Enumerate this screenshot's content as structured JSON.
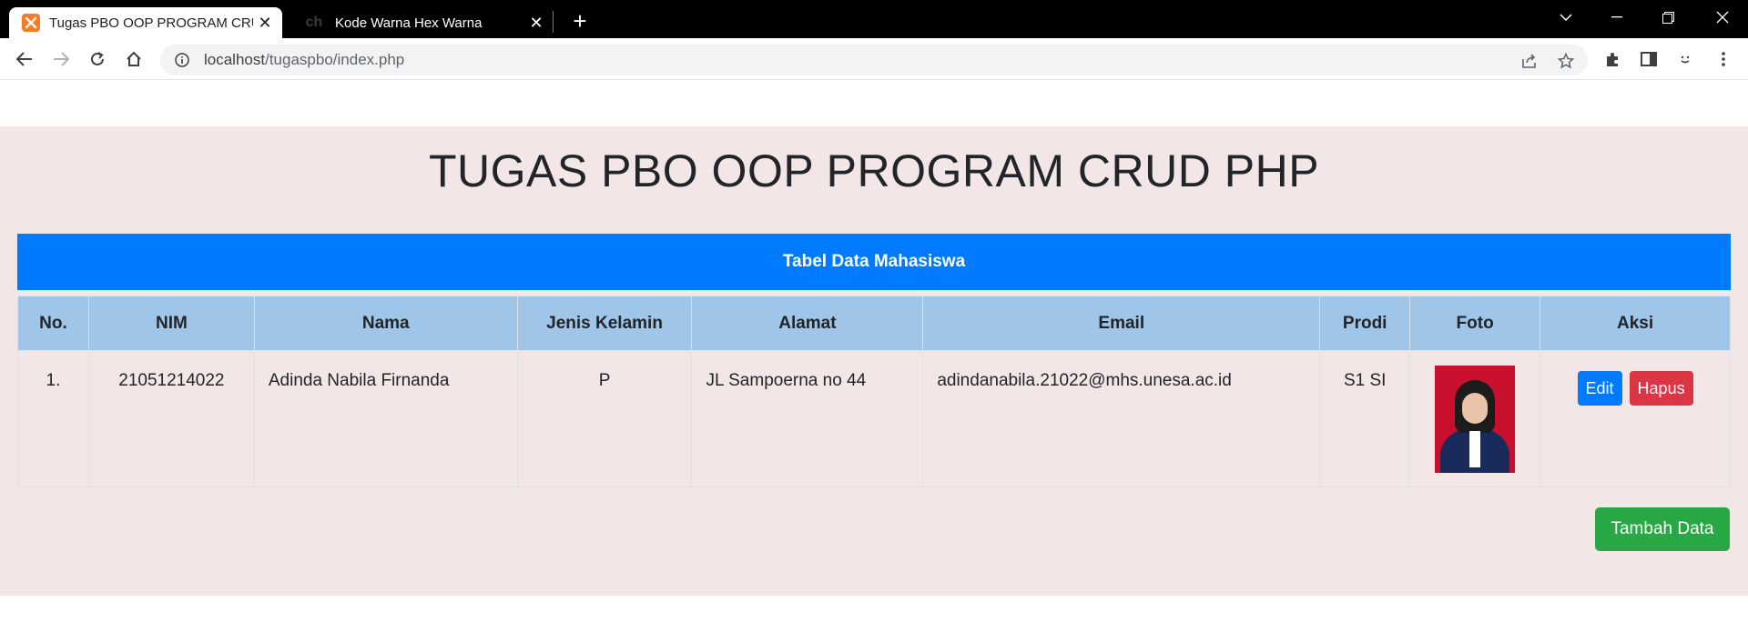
{
  "browser": {
    "tabs": [
      {
        "title": "Tugas PBO OOP PROGRAM CRUD PHP",
        "active": true,
        "favicon": "xampp-icon"
      },
      {
        "title": "Kode Warna Hex Warna",
        "active": false,
        "favicon": "ch"
      }
    ],
    "url_host": "localhost",
    "url_path": "/tugaspbo/index.php"
  },
  "page": {
    "title": "TUGAS PBO OOP PROGRAM CRUD PHP",
    "table_title": "Tabel Data Mahasiswa",
    "columns": [
      "No.",
      "NIM",
      "Nama",
      "Jenis Kelamin",
      "Alamat",
      "Email",
      "Prodi",
      "Foto",
      "Aksi"
    ],
    "rows": [
      {
        "no": "1.",
        "nim": "21051214022",
        "nama": "Adinda Nabila Firnanda",
        "jenis_kelamin": "P",
        "alamat": "JL Sampoerna no 44",
        "email": "adindanabila.21022@mhs.unesa.ac.id",
        "prodi": "S1 SI",
        "edit_label": "Edit",
        "hapus_label": "Hapus"
      }
    ],
    "add_button": "Tambah Data"
  },
  "colors": {
    "page_bg": "#f3e6e6",
    "table_header_bar": "#007bff",
    "column_header": "#9fc5e8",
    "edit": "#007bff",
    "hapus": "#dc3545",
    "add": "#28a745"
  }
}
